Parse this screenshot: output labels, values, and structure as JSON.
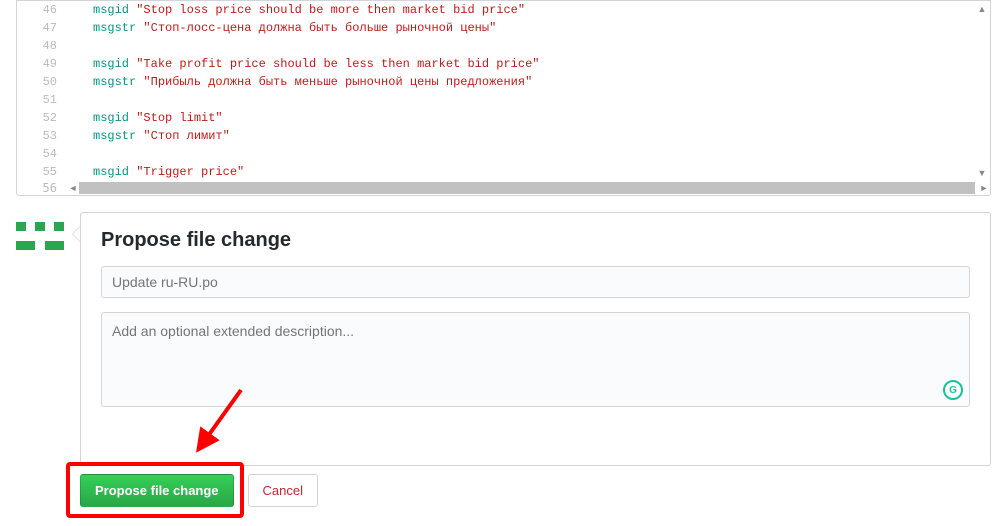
{
  "code": {
    "lines": [
      {
        "num": 46,
        "key": "msgid",
        "value": "\"Stop loss price should be more then market bid price\""
      },
      {
        "num": 47,
        "key": "msgstr",
        "value": "\"Стоп-лосс-цена должна быть больше рыночной цены\""
      },
      {
        "num": 48,
        "key": "",
        "value": ""
      },
      {
        "num": 49,
        "key": "msgid",
        "value": "\"Take profit price should be less then market bid price\""
      },
      {
        "num": 50,
        "key": "msgstr",
        "value": "\"Прибыль должна быть меньше рыночной цены предложения\""
      },
      {
        "num": 51,
        "key": "",
        "value": ""
      },
      {
        "num": 52,
        "key": "msgid",
        "value": "\"Stop limit\""
      },
      {
        "num": 53,
        "key": "msgstr",
        "value": "\"Стоп лимит\""
      },
      {
        "num": 54,
        "key": "",
        "value": ""
      },
      {
        "num": 55,
        "key": "msgid",
        "value": "\"Trigger price\""
      }
    ],
    "overflow_line": 56
  },
  "propose": {
    "heading": "Propose file change",
    "title_placeholder": "Update ru-RU.po",
    "desc_placeholder": "Add an optional extended description...",
    "grammarly_badge": "G"
  },
  "actions": {
    "primary": "Propose file change",
    "cancel": "Cancel"
  },
  "avatar_pattern": [
    0,
    0,
    0,
    0,
    0,
    1,
    0,
    1,
    0,
    1,
    0,
    0,
    0,
    0,
    0,
    1,
    1,
    0,
    1,
    1,
    0,
    0,
    0,
    0,
    0
  ]
}
